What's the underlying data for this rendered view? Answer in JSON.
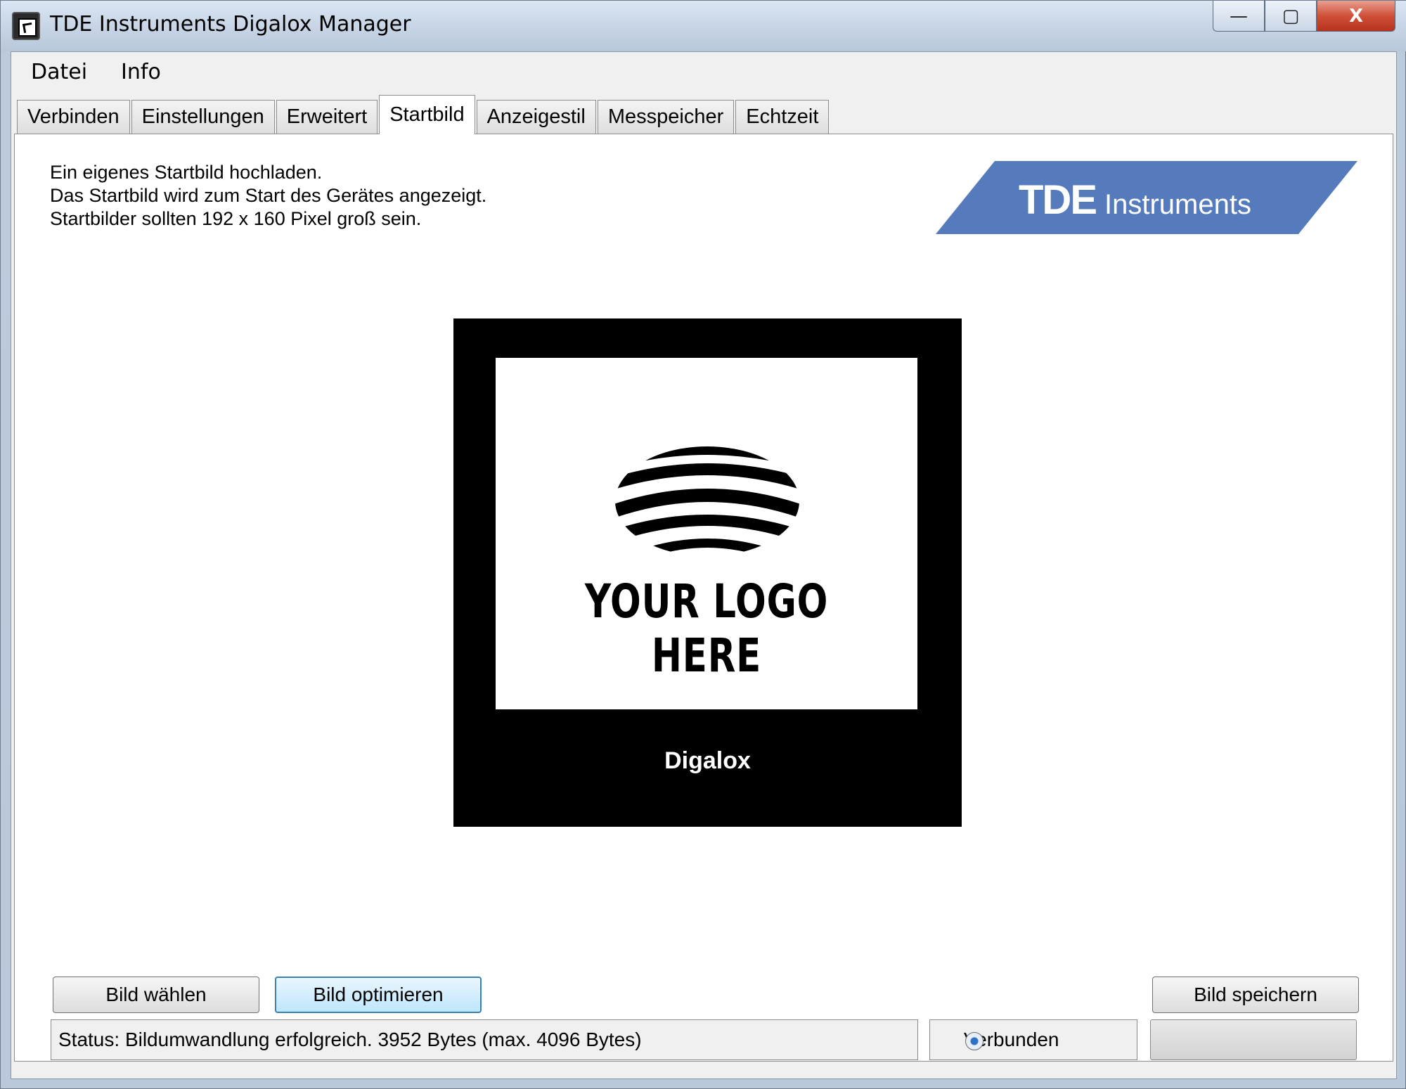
{
  "window": {
    "title": "TDE Instruments Digalox Manager",
    "caption_buttons": {
      "minimize": "—",
      "maximize": "▢",
      "close": "X"
    }
  },
  "menu": [
    "Datei",
    "Info"
  ],
  "tabs": [
    "Verbinden",
    "Einstellungen",
    "Erweitert",
    "Startbild",
    "Anzeigestil",
    "Messpeicher",
    "Echtzeit"
  ],
  "active_tab": "Startbild",
  "intro": [
    "Ein eigenes Startbild hochladen.",
    "Das Startbild wird zum Start des Gerätes angezeigt.",
    "Startbilder sollten 192 x 160 Pixel groß sein."
  ],
  "brand_logo": {
    "bold": "TDE",
    "rest": "Instruments",
    "color": "#557bbd"
  },
  "preview": {
    "logo_text": "YOUR LOGO HERE",
    "device_label": "Digalox"
  },
  "buttons": {
    "choose": "Bild wählen",
    "optimize": "Bild optimieren",
    "save": "Bild speichern"
  },
  "status": {
    "text": "Status: Bildumwandlung erfolgreich.  3952 Bytes (max. 4096 Bytes)",
    "connection": "Verbunden",
    "progress": 0
  }
}
